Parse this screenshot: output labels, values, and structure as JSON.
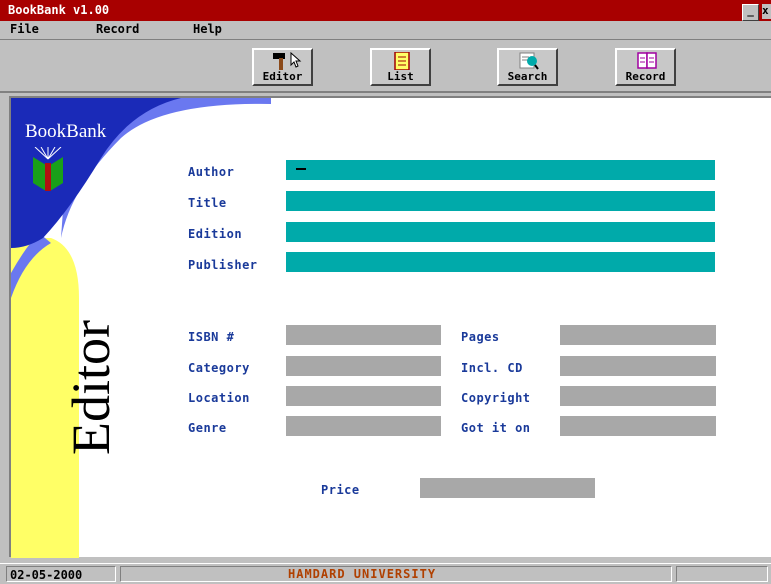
{
  "app": {
    "title": "BookBank v1.00"
  },
  "window_controls": {
    "minimize": "_",
    "close": "x"
  },
  "menu": [
    "File",
    "Record",
    "Help"
  ],
  "toolbar": {
    "editor": "Editor",
    "list": "List",
    "search": "Search",
    "record": "Record"
  },
  "brand": {
    "name": "BookBank",
    "section": "Editor"
  },
  "form": {
    "author": {
      "label": "Author",
      "value": ""
    },
    "title": {
      "label": "Title",
      "value": ""
    },
    "edition": {
      "label": "Edition",
      "value": ""
    },
    "publisher": {
      "label": "Publisher",
      "value": ""
    },
    "isbn": {
      "label": "ISBN #",
      "value": ""
    },
    "category": {
      "label": "Category",
      "value": ""
    },
    "location": {
      "label": "Location",
      "value": ""
    },
    "genre": {
      "label": "Genre",
      "value": ""
    },
    "pages": {
      "label": "Pages",
      "value": ""
    },
    "incl_cd": {
      "label": "Incl. CD",
      "value": ""
    },
    "copyright": {
      "label": "Copyright",
      "value": ""
    },
    "got_it_on": {
      "label": "Got it on",
      "value": ""
    },
    "price": {
      "label": "Price",
      "value": ""
    }
  },
  "status": {
    "date": "02-05-2000",
    "org": "HAMDARD UNIVERSITY"
  },
  "colors": {
    "titlebar": "#a80000",
    "field_active": "#00aaaa",
    "field_inactive": "#a8a8a8",
    "label": "#1a3a9a",
    "brand_blue": "#1a2ab8",
    "brand_yellow": "#ffff66"
  }
}
